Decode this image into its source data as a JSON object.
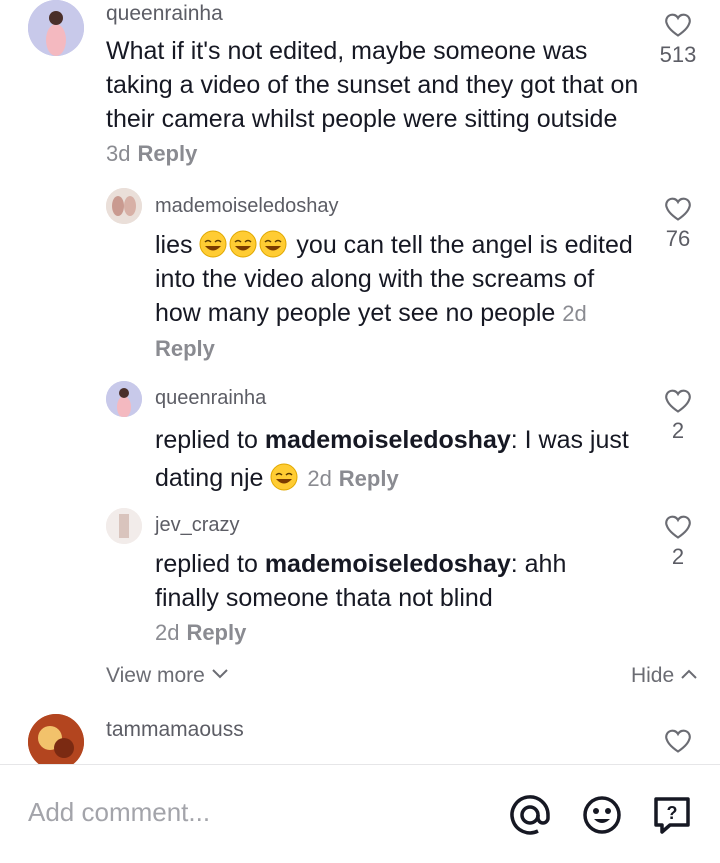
{
  "comments": [
    {
      "username": "queenrainha",
      "text": "What if it's not edited, maybe someone was taking a video of the sunset and they got that on their camera whilst people were sitting outside",
      "age": "3d",
      "reply": "Reply",
      "likes": "513"
    },
    {
      "username": "mademoiseledoshay",
      "text_before": "lies",
      "text_after": "you can tell the angel is edited into the video along with the screams of how many people yet see no people",
      "age": "2d",
      "reply": "Reply",
      "likes": "76"
    },
    {
      "username": "queenrainha",
      "prefix": "replied to",
      "mention": "mademoiseledoshay",
      "text": ": I was just dating nje",
      "age": "2d",
      "reply": "Reply",
      "likes": "2"
    },
    {
      "username": "jev_crazy",
      "prefix": "replied to",
      "mention": "mademoiseledoshay",
      "text": ": ahh finally someone thata not blind",
      "age": "2d",
      "reply": "Reply",
      "likes": "2"
    },
    {
      "username": "tammamaouss"
    }
  ],
  "links": {
    "view_more": "View more",
    "hide": "Hide"
  },
  "comment_bar": {
    "placeholder": "Add comment...",
    "icons": [
      "at-icon",
      "emoji-icon",
      "question-icon"
    ]
  }
}
